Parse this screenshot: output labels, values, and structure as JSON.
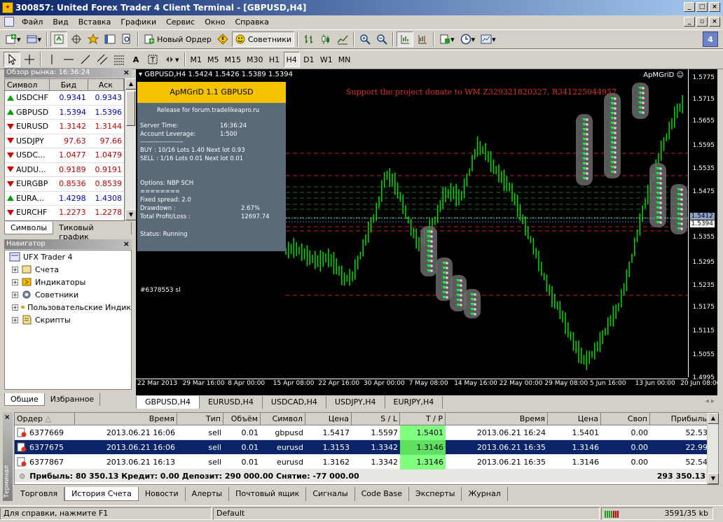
{
  "window": {
    "title": "300857: United Forex Trader 4 Client Terminal - [GBPUSD,H4]"
  },
  "menu": [
    "Файл",
    "Вид",
    "Вставка",
    "Графики",
    "Сервис",
    "Окно",
    "Справка"
  ],
  "toolbar": {
    "new_order": "Новый Ордер",
    "advisors": "Советники",
    "badge": "4"
  },
  "timeframes": [
    "M1",
    "M5",
    "M15",
    "M30",
    "H1",
    "H4",
    "D1",
    "W1",
    "MN"
  ],
  "timeframe_active": "H4",
  "market_watch": {
    "title": "Обзор рынка: 16:36:24",
    "headers": [
      "Символ",
      "Бид",
      "Аск"
    ],
    "rows": [
      {
        "symbol": "USDCHF",
        "bid": "0.9341",
        "ask": "0.9343",
        "dir": "up"
      },
      {
        "symbol": "GBPUSD",
        "bid": "1.5394",
        "ask": "1.5396",
        "dir": "up"
      },
      {
        "symbol": "EURUSD",
        "bid": "1.3142",
        "ask": "1.3144",
        "dir": "down"
      },
      {
        "symbol": "USDJPY",
        "bid": "97.63",
        "ask": "97.66",
        "dir": "down"
      },
      {
        "symbol": "USDC...",
        "bid": "1.0477",
        "ask": "1.0479",
        "dir": "down"
      },
      {
        "symbol": "AUDU...",
        "bid": "0.9189",
        "ask": "0.9191",
        "dir": "down"
      },
      {
        "symbol": "EURGBP",
        "bid": "0.8536",
        "ask": "0.8539",
        "dir": "down"
      },
      {
        "symbol": "EURA...",
        "bid": "1.4298",
        "ask": "1.4308",
        "dir": "up"
      },
      {
        "symbol": "EURCHF",
        "bid": "1.2273",
        "ask": "1.2278",
        "dir": "down"
      }
    ],
    "tabs": [
      "Символы",
      "Тиковый график"
    ]
  },
  "navigator": {
    "title": "Навигатор",
    "root": "UFX Trader 4",
    "items": [
      "Счета",
      "Индикаторы",
      "Советники",
      "Пользовательские Индик",
      "Скрипты"
    ],
    "tabs": [
      "Общие",
      "Избранное"
    ]
  },
  "chart": {
    "header": "GBPUSD,H4  1.5424 1.5426 1.5389 1.5394",
    "expert_label": "ApMGriD",
    "donate": "Support the project donate to WM Z329321820327, R341225044957",
    "order_label": "#6378553 sl",
    "prices": [
      "1.5775",
      "1.5715",
      "1.5655",
      "1.5595",
      "1.5535",
      "1.5475",
      "1.5412",
      "1.5394",
      "1.5355",
      "1.5295",
      "1.5235",
      "1.5175",
      "1.5115",
      "1.5055",
      "1.4995"
    ],
    "times": [
      "22 Mar 2013",
      "29 Mar 16:00",
      "8 Apr 00:00",
      "15 Apr 08:00",
      "22 Apr 16:00",
      "30 Apr 00:00",
      "7 May 08:00",
      "14 May 16:00",
      "22 May 00:00",
      "29 May 08:00",
      "5 Jun 16:00",
      "13 Jun 00:00",
      "20 Jun 08:00"
    ],
    "info": {
      "title": "ApMGriD 1.1 GBPUSD",
      "release": "Release for forum.tradelikeapro.ru",
      "server_time_label": "Server Time:",
      "server_time": "16:36:24",
      "leverage_label": "Account Leverage:",
      "leverage": "1:500",
      "sep1": "--------------------",
      "buy": "BUY : 10/16  Lots 1.40 Next lot 0.93",
      "sell": "SELL : 1/16  Lots 0.01 Next lot 0.01",
      "options": "Options: NBP SCH",
      "sep2": "========",
      "spread": "Fixed spread: 2.0",
      "drawdown_label": "Drawdown :",
      "drawdown": "2.67%",
      "profit_label": "Total Profit/Loss :",
      "profit": "12697.74",
      "status": "Status: Running"
    },
    "tabs": [
      "GBPUSD,H4",
      "EURUSD,H4",
      "USDCAD,H4",
      "USDJPY,H4",
      "EURJPY,H4"
    ]
  },
  "terminal": {
    "side_label": "Терминал",
    "headers": [
      "Ордер",
      "Время",
      "Тип",
      "Объём",
      "Символ",
      "Цена",
      "S / L",
      "T / P",
      "Время",
      "Цена",
      "Своп",
      "Прибыль"
    ],
    "rows": [
      {
        "order": "6377669",
        "time": "2013.06.21 16:06",
        "type": "sell",
        "volume": "0.01",
        "symbol": "gbpusd",
        "price": "1.5417",
        "sl": "1.5597",
        "tp": "1.5401",
        "close_time": "2013.06.21 16:24",
        "close_price": "1.5401",
        "swap": "0.00",
        "profit": "52.53"
      },
      {
        "order": "6377675",
        "time": "2013.06.21 16:06",
        "type": "sell",
        "volume": "0.01",
        "symbol": "eurusd",
        "price": "1.3153",
        "sl": "1.3342",
        "tp": "1.3146",
        "close_time": "2013.06.21 16:35",
        "close_price": "1.3146",
        "swap": "0.00",
        "profit": "22.99"
      },
      {
        "order": "6377867",
        "time": "2013.06.21 16:13",
        "type": "sell",
        "volume": "0.01",
        "symbol": "eurusd",
        "price": "1.3162",
        "sl": "1.3342",
        "tp": "1.3146",
        "close_time": "2013.06.21 16:35",
        "close_price": "1.3146",
        "swap": "0.00",
        "profit": "52.54"
      }
    ],
    "totals": "Прибыль: 80 350.13  Кредит: 0.00  Депозит: 290 000.00  Снятие: -77 000.00",
    "total_profit": "293 350.13",
    "tabs": [
      "Торговля",
      "История Счета",
      "Новости",
      "Алерты",
      "Почтовый ящик",
      "Сигналы",
      "Code Base",
      "Эксперты",
      "Журнал"
    ]
  },
  "status": {
    "help": "Для справки, нажмите F1",
    "profile": "Default",
    "traffic": "3591/35 kb"
  }
}
